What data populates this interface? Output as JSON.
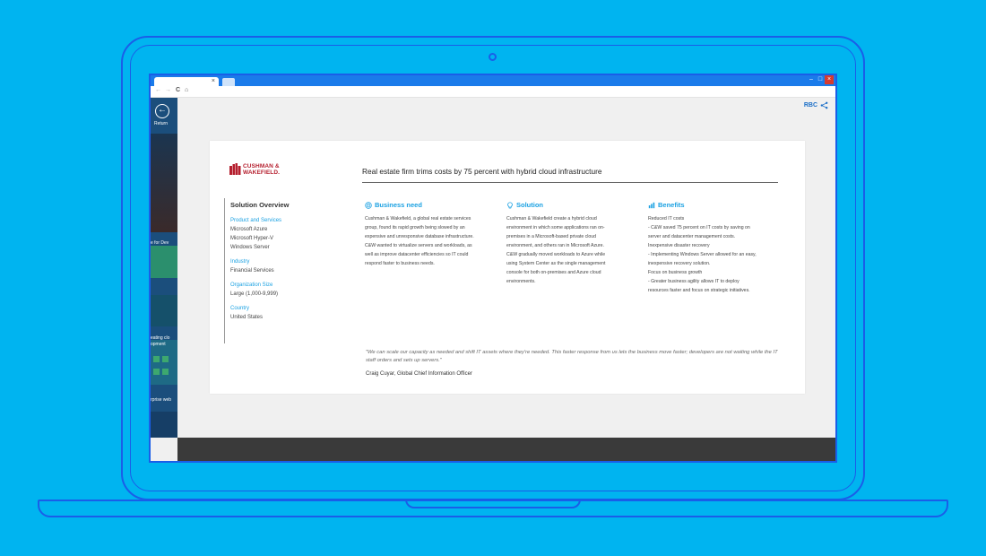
{
  "browser": {
    "tab_close": "×",
    "nav_back": "←",
    "nav_forward": "→",
    "nav_reload": "C",
    "nav_home": "⌂",
    "win_minimize": "–",
    "win_maximize": "□",
    "win_close": "×"
  },
  "left_rail": {
    "return_label": "Return",
    "snippets": [
      "e for Dev",
      "eating clo",
      "opment",
      "rprise web"
    ]
  },
  "toolbar": {
    "rbc_label": "RBC"
  },
  "case_study": {
    "logo_line1": "CUSHMAN &",
    "logo_line2": "WAKEFIELD.",
    "headline": "Real estate firm trims costs by 75 percent with hybrid cloud infrastructure",
    "overview": {
      "title": "Solution Overview",
      "product_label": "Product and Services",
      "products": [
        "Microsoft Azure",
        "Microsoft Hyper-V",
        "Windows Server"
      ],
      "industry_label": "Industry",
      "industry": "Financial Services",
      "size_label": "Organization Size",
      "size": "Large (1,000-9,999)",
      "country_label": "Country",
      "country": "United States"
    },
    "business_need": {
      "title": "Business need",
      "lines": [
        "Cushman & Wakefield, a global real estate services",
        "group, found its rapid growth being slowed by an",
        "expensive and unresponsive database infrastructure.",
        "C&W wanted to virtualize servers and workloads, as",
        "well as improve datacenter efficiencies so IT could",
        "respond faster to business needs."
      ]
    },
    "solution": {
      "title": "Solution",
      "lines": [
        "Cushman & Wakefield create a hybrid cloud",
        "environment in which some applications ran on-",
        "premises in a Microsoft-based private cloud",
        "environment, and others ran in Microsoft Azure.",
        "C&W gradually moved workloads to Azure while",
        "using System Center as the single management",
        "console for both on-premises and Azure cloud",
        "environments."
      ]
    },
    "benefits": {
      "title": "Benefits",
      "lines": [
        "Reduced IT costs",
        "-  C&W saved 75 percent on IT costs by saving on",
        "server and datacenter management costs.",
        "Inexpensive disaster recovery",
        "-  Implementing Windows Server allowed for an easy,",
        "inexpensive recovery solution.",
        "Focus on business growth",
        "-  Greater business agility allows IT to deploy",
        "resources faster and focus on strategic initiatives."
      ]
    },
    "quote": "\"We can scale our capacity as needed and shift IT assets where they're needed. This faster response from us lets the business move faster; developers are not waiting while the IT staff orders and sets up servers.\"",
    "attribution": "Craig Cuyar, Global Chief Information Officer"
  },
  "colors": {
    "background": "#00b4f0",
    "outline": "#1a5ee8",
    "accent": "#1ba1e2",
    "brand_red": "#b51f2e"
  }
}
